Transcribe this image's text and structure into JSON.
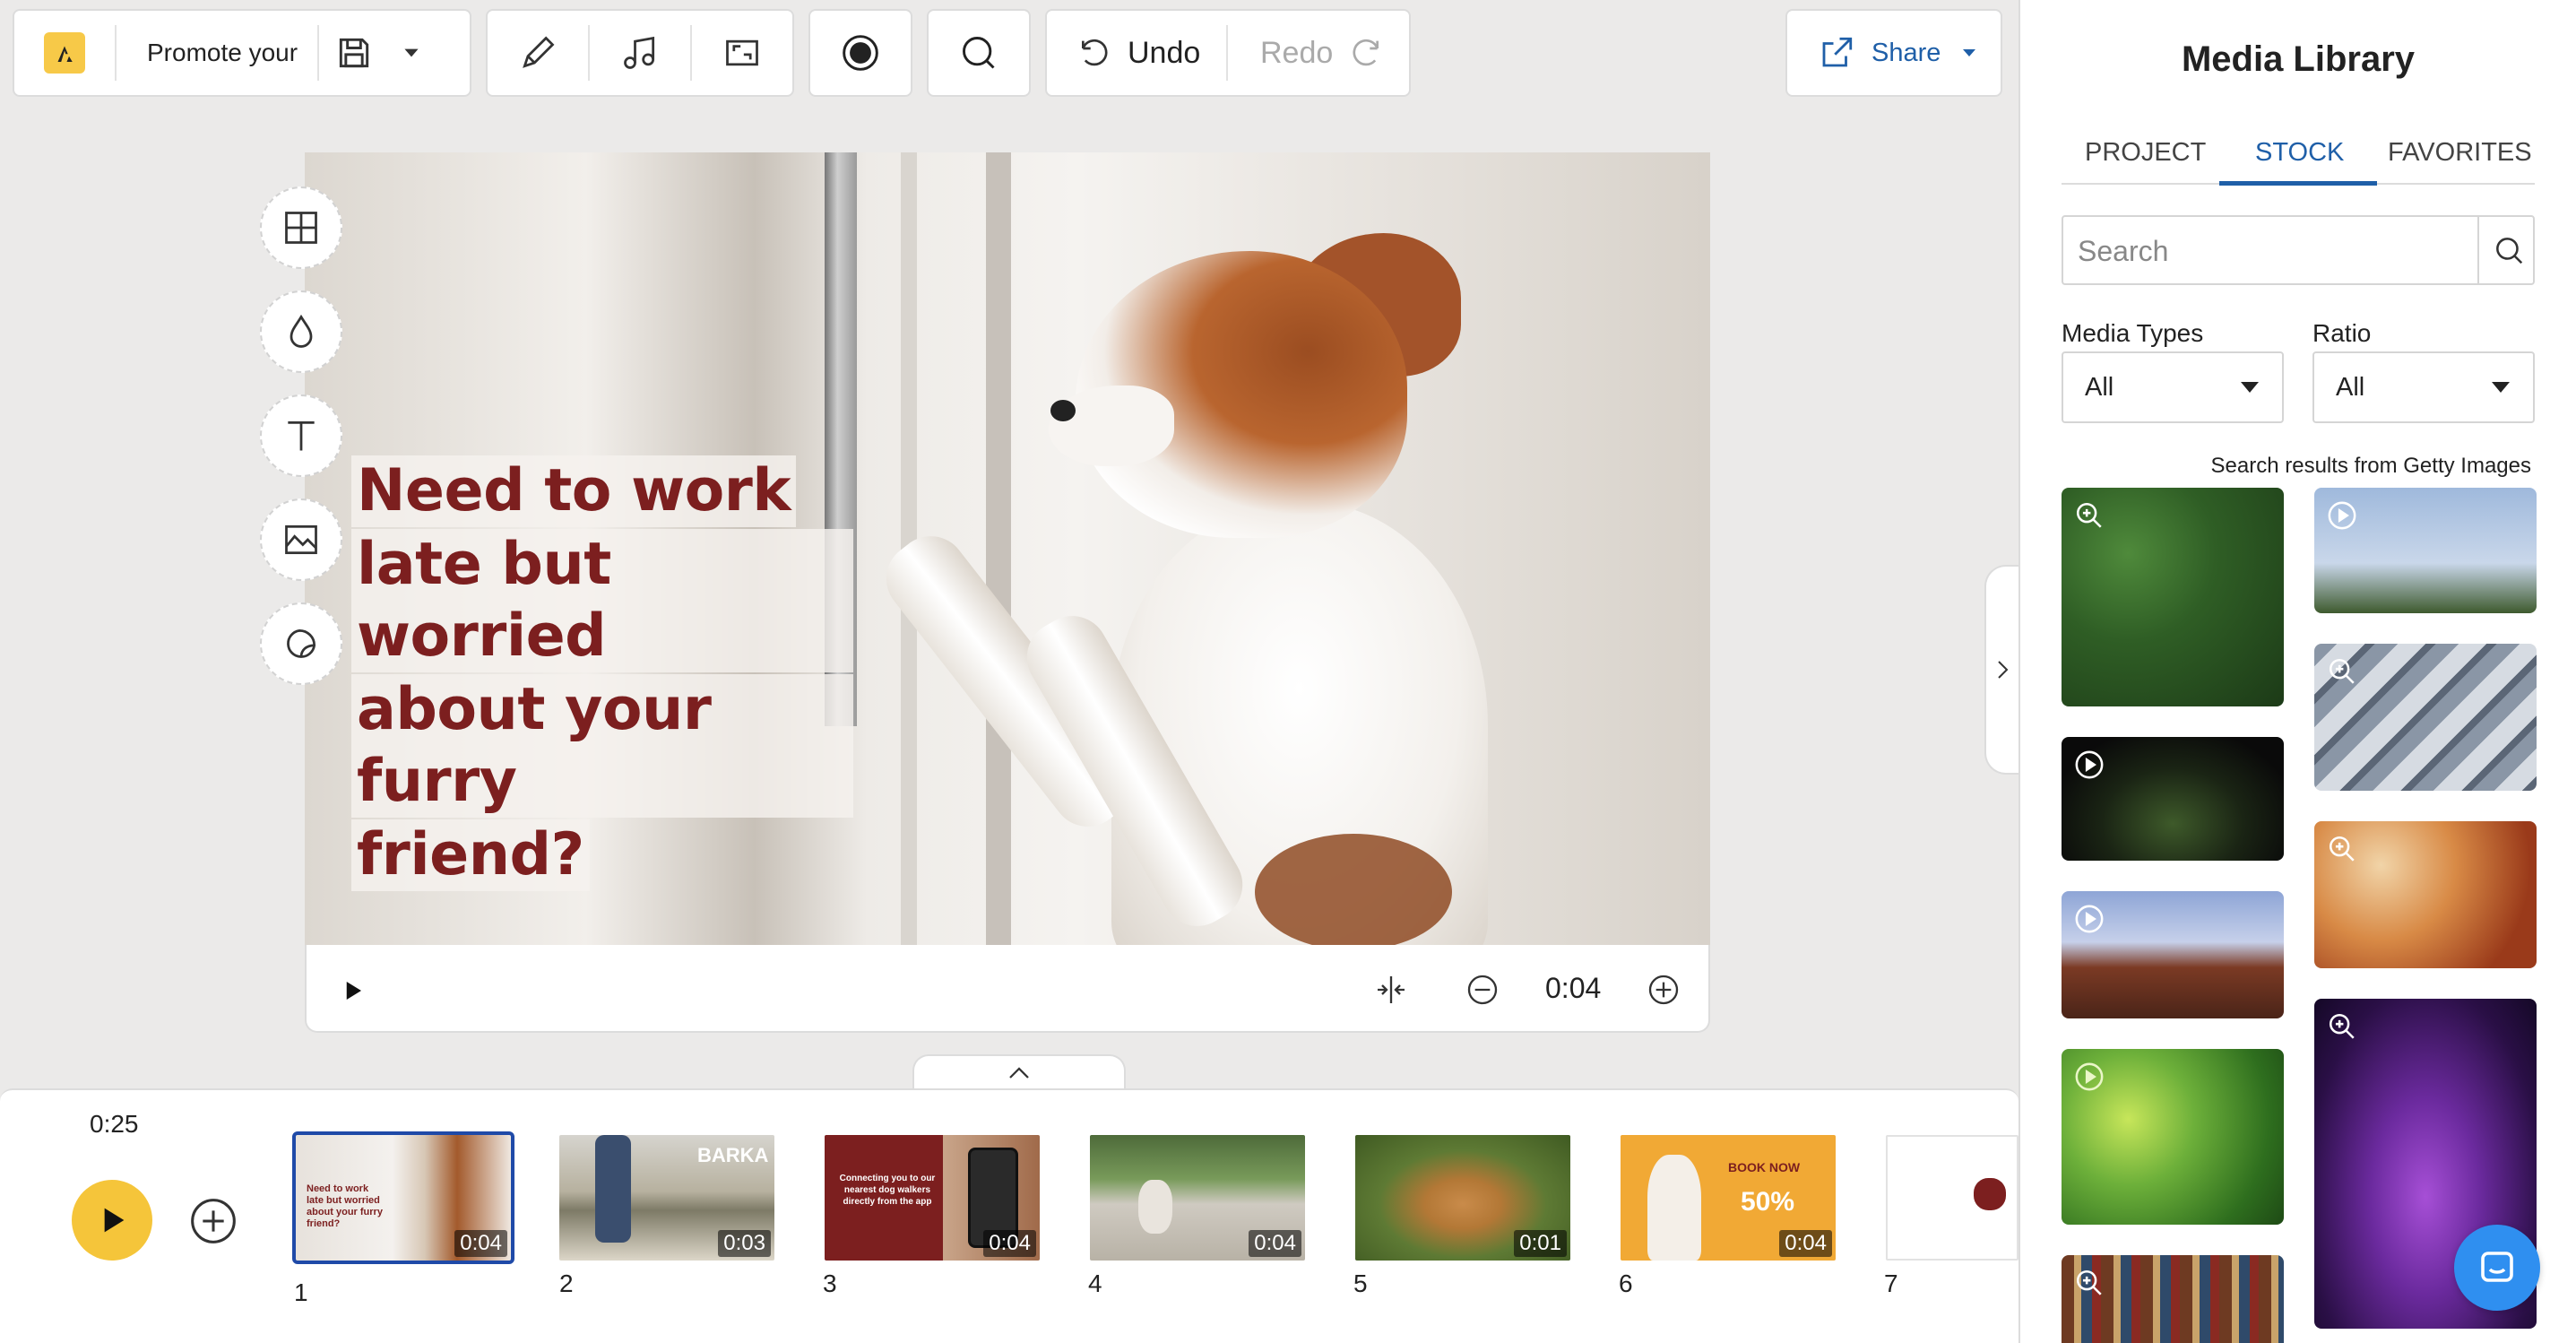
{
  "toolbar": {
    "project_name": "Promote your b",
    "undo_label": "Undo",
    "redo_label": "Redo",
    "share_label": "Share",
    "icons": [
      "logo-icon",
      "save-icon",
      "dropdown-icon",
      "pen-icon",
      "music-icon",
      "resize-icon",
      "record-icon",
      "search-icon",
      "undo-icon",
      "redo-icon",
      "share-icon"
    ]
  },
  "canvas": {
    "headline_lines": [
      "Need to work",
      "late but worried",
      "about your furry",
      "friend?"
    ],
    "headline_color": "#7c1f1f",
    "side_tools": [
      "layout-icon",
      "color-drop-icon",
      "text-icon",
      "image-icon",
      "sticker-icon"
    ]
  },
  "player": {
    "time": "0:04"
  },
  "timeline": {
    "total_time": "0:25",
    "clips": [
      {
        "number": "1",
        "duration": "0:04",
        "selected": true
      },
      {
        "number": "2",
        "duration": "0:03",
        "selected": false,
        "text": "BARKA"
      },
      {
        "number": "3",
        "duration": "0:04",
        "selected": false
      },
      {
        "number": "4",
        "duration": "0:04",
        "selected": false
      },
      {
        "number": "5",
        "duration": "0:01",
        "selected": false
      },
      {
        "number": "6",
        "duration": "0:04",
        "selected": false,
        "text": "BOOK NOW"
      },
      {
        "number": "7",
        "duration": "",
        "selected": false
      }
    ]
  },
  "media_library": {
    "title": "Media Library",
    "tabs": [
      {
        "label": "PROJECT",
        "active": false
      },
      {
        "label": "STOCK",
        "active": true
      },
      {
        "label": "FAVORITES",
        "active": false
      }
    ],
    "search_placeholder": "Search",
    "filters": {
      "media_types_label": "Media Types",
      "media_types_value": "All",
      "ratio_label": "Ratio",
      "ratio_value": "All"
    },
    "source_note": "Search results from Getty Images",
    "accent_color": "#1f5fa8"
  }
}
